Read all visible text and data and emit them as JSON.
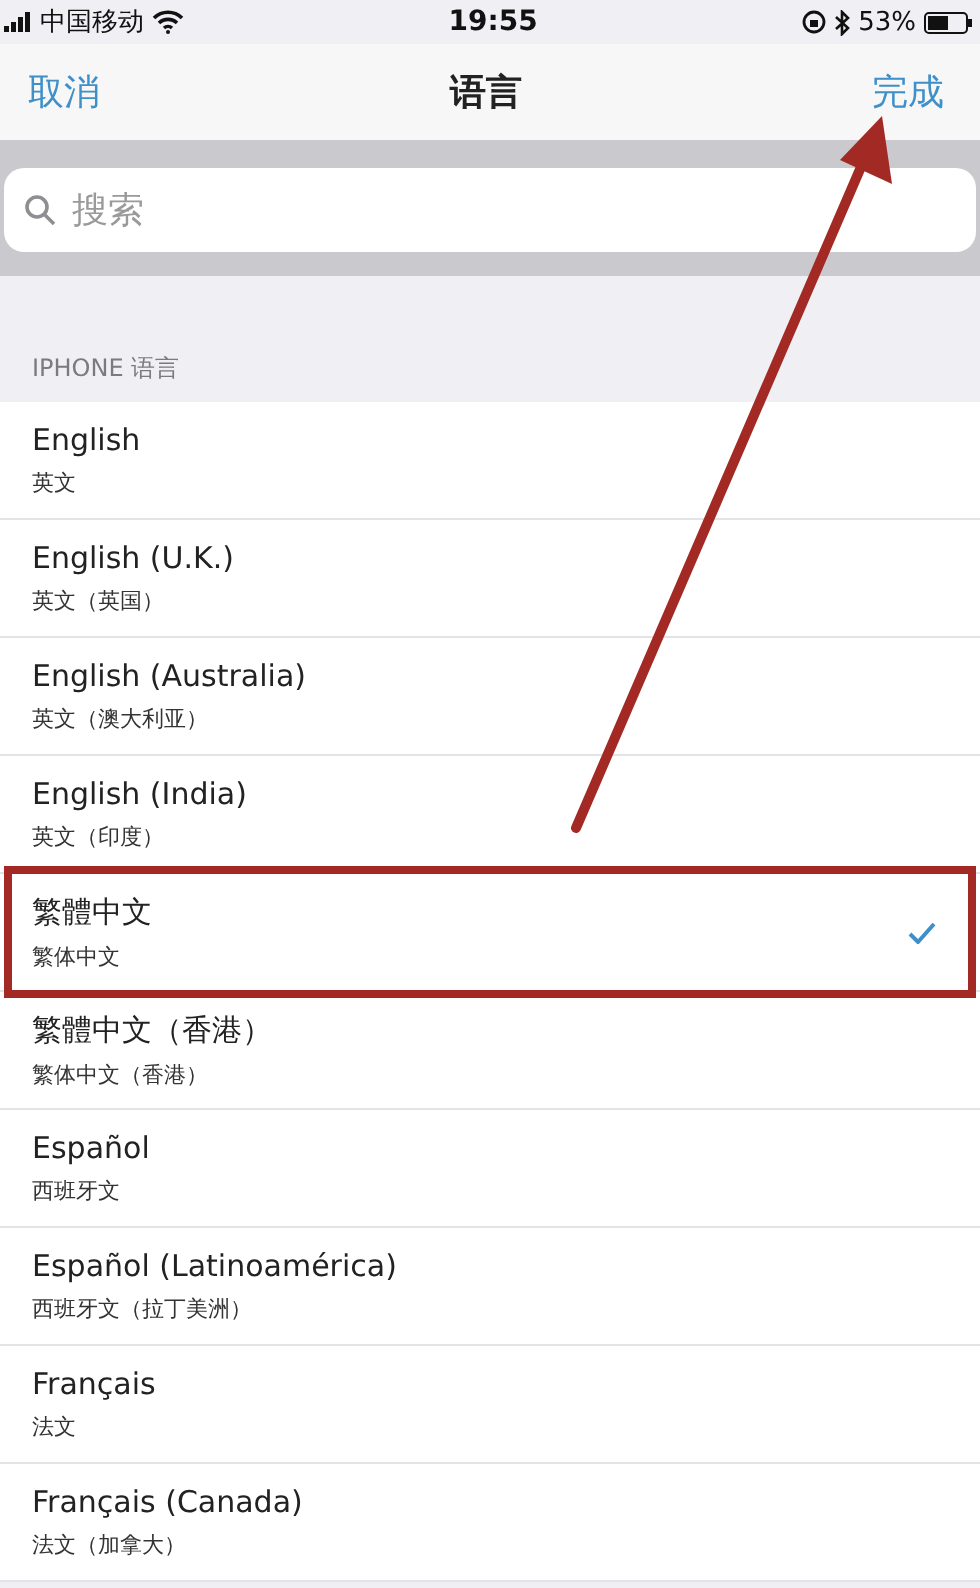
{
  "status_bar": {
    "carrier": "中国移动",
    "time": "19:55",
    "battery": "53%"
  },
  "nav": {
    "cancel": "取消",
    "title": "语言",
    "done": "完成"
  },
  "search": {
    "placeholder": "搜索"
  },
  "section_header": "IPHONE 语言",
  "languages": [
    {
      "name": "English",
      "native": "英文",
      "selected": false,
      "highlighted": false
    },
    {
      "name": "English (U.K.)",
      "native": "英文（英国）",
      "selected": false,
      "highlighted": false
    },
    {
      "name": "English (Australia)",
      "native": "英文（澳大利亚）",
      "selected": false,
      "highlighted": false
    },
    {
      "name": "English (India)",
      "native": "英文（印度）",
      "selected": false,
      "highlighted": false
    },
    {
      "name": "繁體中文",
      "native": "繁体中文",
      "selected": true,
      "highlighted": true
    },
    {
      "name": "繁體中文（香港）",
      "native": "繁体中文（香港）",
      "selected": false,
      "highlighted": false
    },
    {
      "name": "Español",
      "native": "西班牙文",
      "selected": false,
      "highlighted": false
    },
    {
      "name": "Español (Latinoamérica)",
      "native": "西班牙文（拉丁美洲）",
      "selected": false,
      "highlighted": false
    },
    {
      "name": "Français",
      "native": "法文",
      "selected": false,
      "highlighted": false
    },
    {
      "name": "Français (Canada)",
      "native": "法文（加拿大）",
      "selected": false,
      "highlighted": false
    }
  ]
}
